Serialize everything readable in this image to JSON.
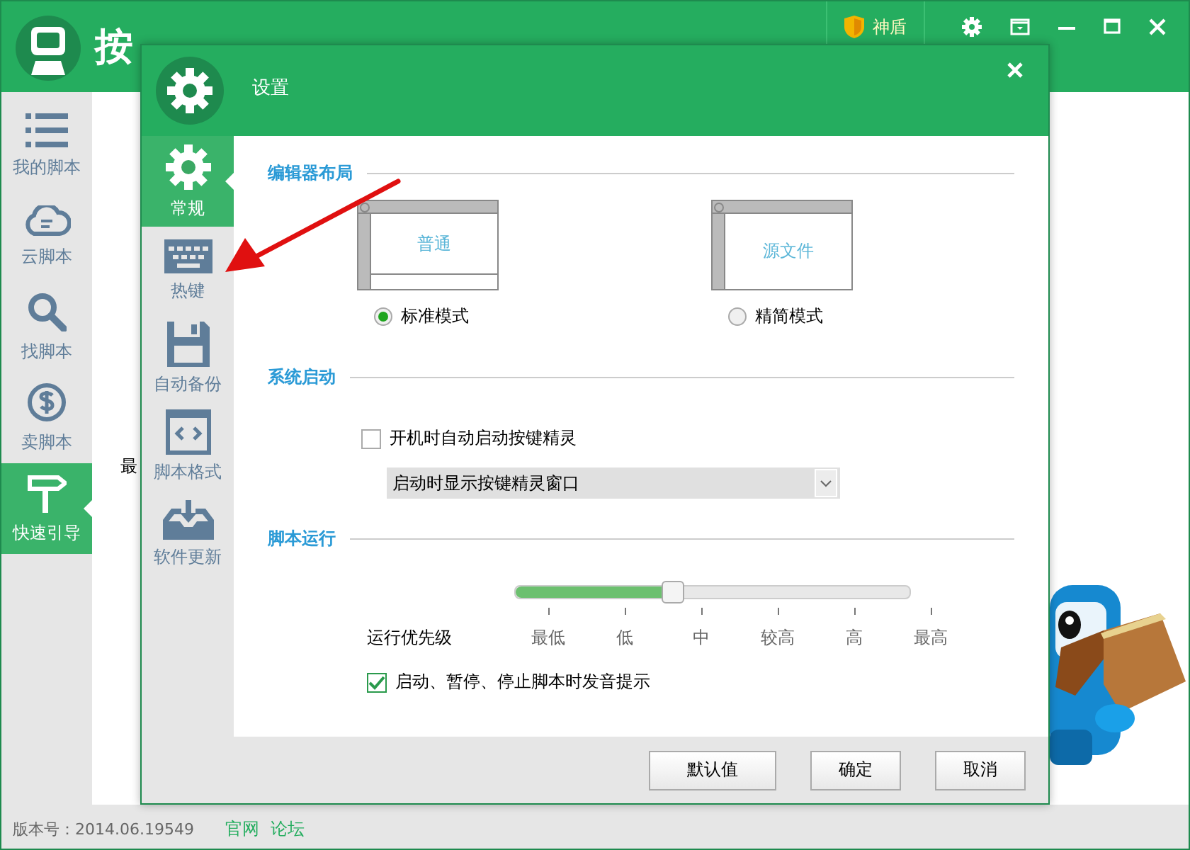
{
  "app": {
    "title": "按",
    "shield_label": "神盾",
    "nav": [
      {
        "label": "我的脚本",
        "kind": "list",
        "selected": false
      },
      {
        "label": "云脚本",
        "kind": "cloud",
        "selected": false
      },
      {
        "label": "找脚本",
        "kind": "search",
        "selected": false
      },
      {
        "label": "卖脚本",
        "kind": "dollar",
        "selected": false
      },
      {
        "label": "快速引导",
        "kind": "signpost",
        "selected": true
      }
    ],
    "content_label": "最",
    "version": "版本号：2014.06.19549",
    "links": [
      "官网",
      "论坛"
    ]
  },
  "dialog": {
    "title": "设置",
    "nav": [
      {
        "label": "常规",
        "kind": "gear",
        "selected": true
      },
      {
        "label": "热键",
        "kind": "keyboard",
        "selected": false
      },
      {
        "label": "自动备份",
        "kind": "disk",
        "selected": false
      },
      {
        "label": "脚本格式",
        "kind": "code",
        "selected": false
      },
      {
        "label": "软件更新",
        "kind": "inbox",
        "selected": false
      }
    ],
    "layout": {
      "heading": "编辑器布局",
      "options": [
        {
          "kind": "split",
          "preview": "普通",
          "label": "标准模式",
          "selected": true
        },
        {
          "kind": "single",
          "preview": "源文件",
          "label": "精简模式",
          "selected": false
        }
      ]
    },
    "startup": {
      "heading": "系统启动",
      "autostart": {
        "label": "开机时自动启动按键精灵",
        "checked": false
      },
      "window_select": {
        "value": "启动时显示按键精灵窗口"
      }
    },
    "run": {
      "heading": "脚本运行",
      "priority": {
        "label": "运行优先级",
        "level": 0.4,
        "ticks": [
          "最低",
          "低",
          "中",
          "较高",
          "高",
          "最高"
        ]
      },
      "sound": {
        "label": "启动、暂停、停止脚本时发音提示",
        "checked": true
      }
    },
    "buttons": [
      "默认值",
      "确定",
      "取消"
    ]
  }
}
